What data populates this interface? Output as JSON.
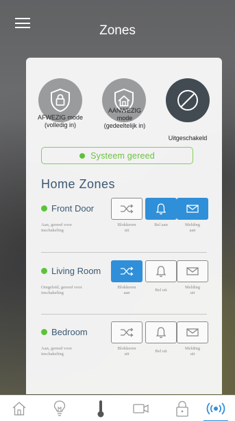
{
  "header": {
    "title": "Zones"
  },
  "modes": [
    {
      "label_line1": "AFWEZIG mode",
      "label_line2": "(volledig in)",
      "icon": "lock-icon"
    },
    {
      "label_line1": "AANWEZIG",
      "label_line2": "mode",
      "label_line3": "(gedeeltelijk in)",
      "icon": "home-lock-icon"
    },
    {
      "label_line1": "Uitgeschakeld",
      "icon": "disabled-icon"
    }
  ],
  "status": {
    "text": "Systeem gereed"
  },
  "section_title": "Home Zones",
  "zones": [
    {
      "name": "Front Door",
      "desc_line1": "Aan, gereed voor",
      "desc_line2": "inschakeling",
      "buttons": [
        {
          "l1": "Blokkeren",
          "l2": "uit"
        },
        {
          "l1": "Bel aan",
          "l2": ""
        },
        {
          "l1": "Melding",
          "l2": "aan"
        }
      ]
    },
    {
      "name": "Living Room",
      "desc_line1": "Omgeleid, gereed voor",
      "desc_line2": "inschakeling",
      "buttons": [
        {
          "l1": "Blokkeren",
          "l2": "aan"
        },
        {
          "l1": "Bel uit",
          "l2": ""
        },
        {
          "l1": "Melding",
          "l2": "uit"
        }
      ]
    },
    {
      "name": "Bedroom",
      "desc_line1": "Aan, gereed voor",
      "desc_line2": "inschakeling",
      "buttons": [
        {
          "l1": "Blokkeren",
          "l2": "uit"
        },
        {
          "l1": "Bel uit",
          "l2": ""
        },
        {
          "l1": "Melding",
          "l2": "uit"
        }
      ]
    }
  ],
  "colors": {
    "accent": "#2f8fd9",
    "ready": "#5cc23a",
    "title": "#3a5873"
  },
  "tabbar": [
    "home-icon",
    "bulb-icon",
    "thermometer-icon",
    "camera-icon",
    "lock-icon",
    "security-icon"
  ]
}
